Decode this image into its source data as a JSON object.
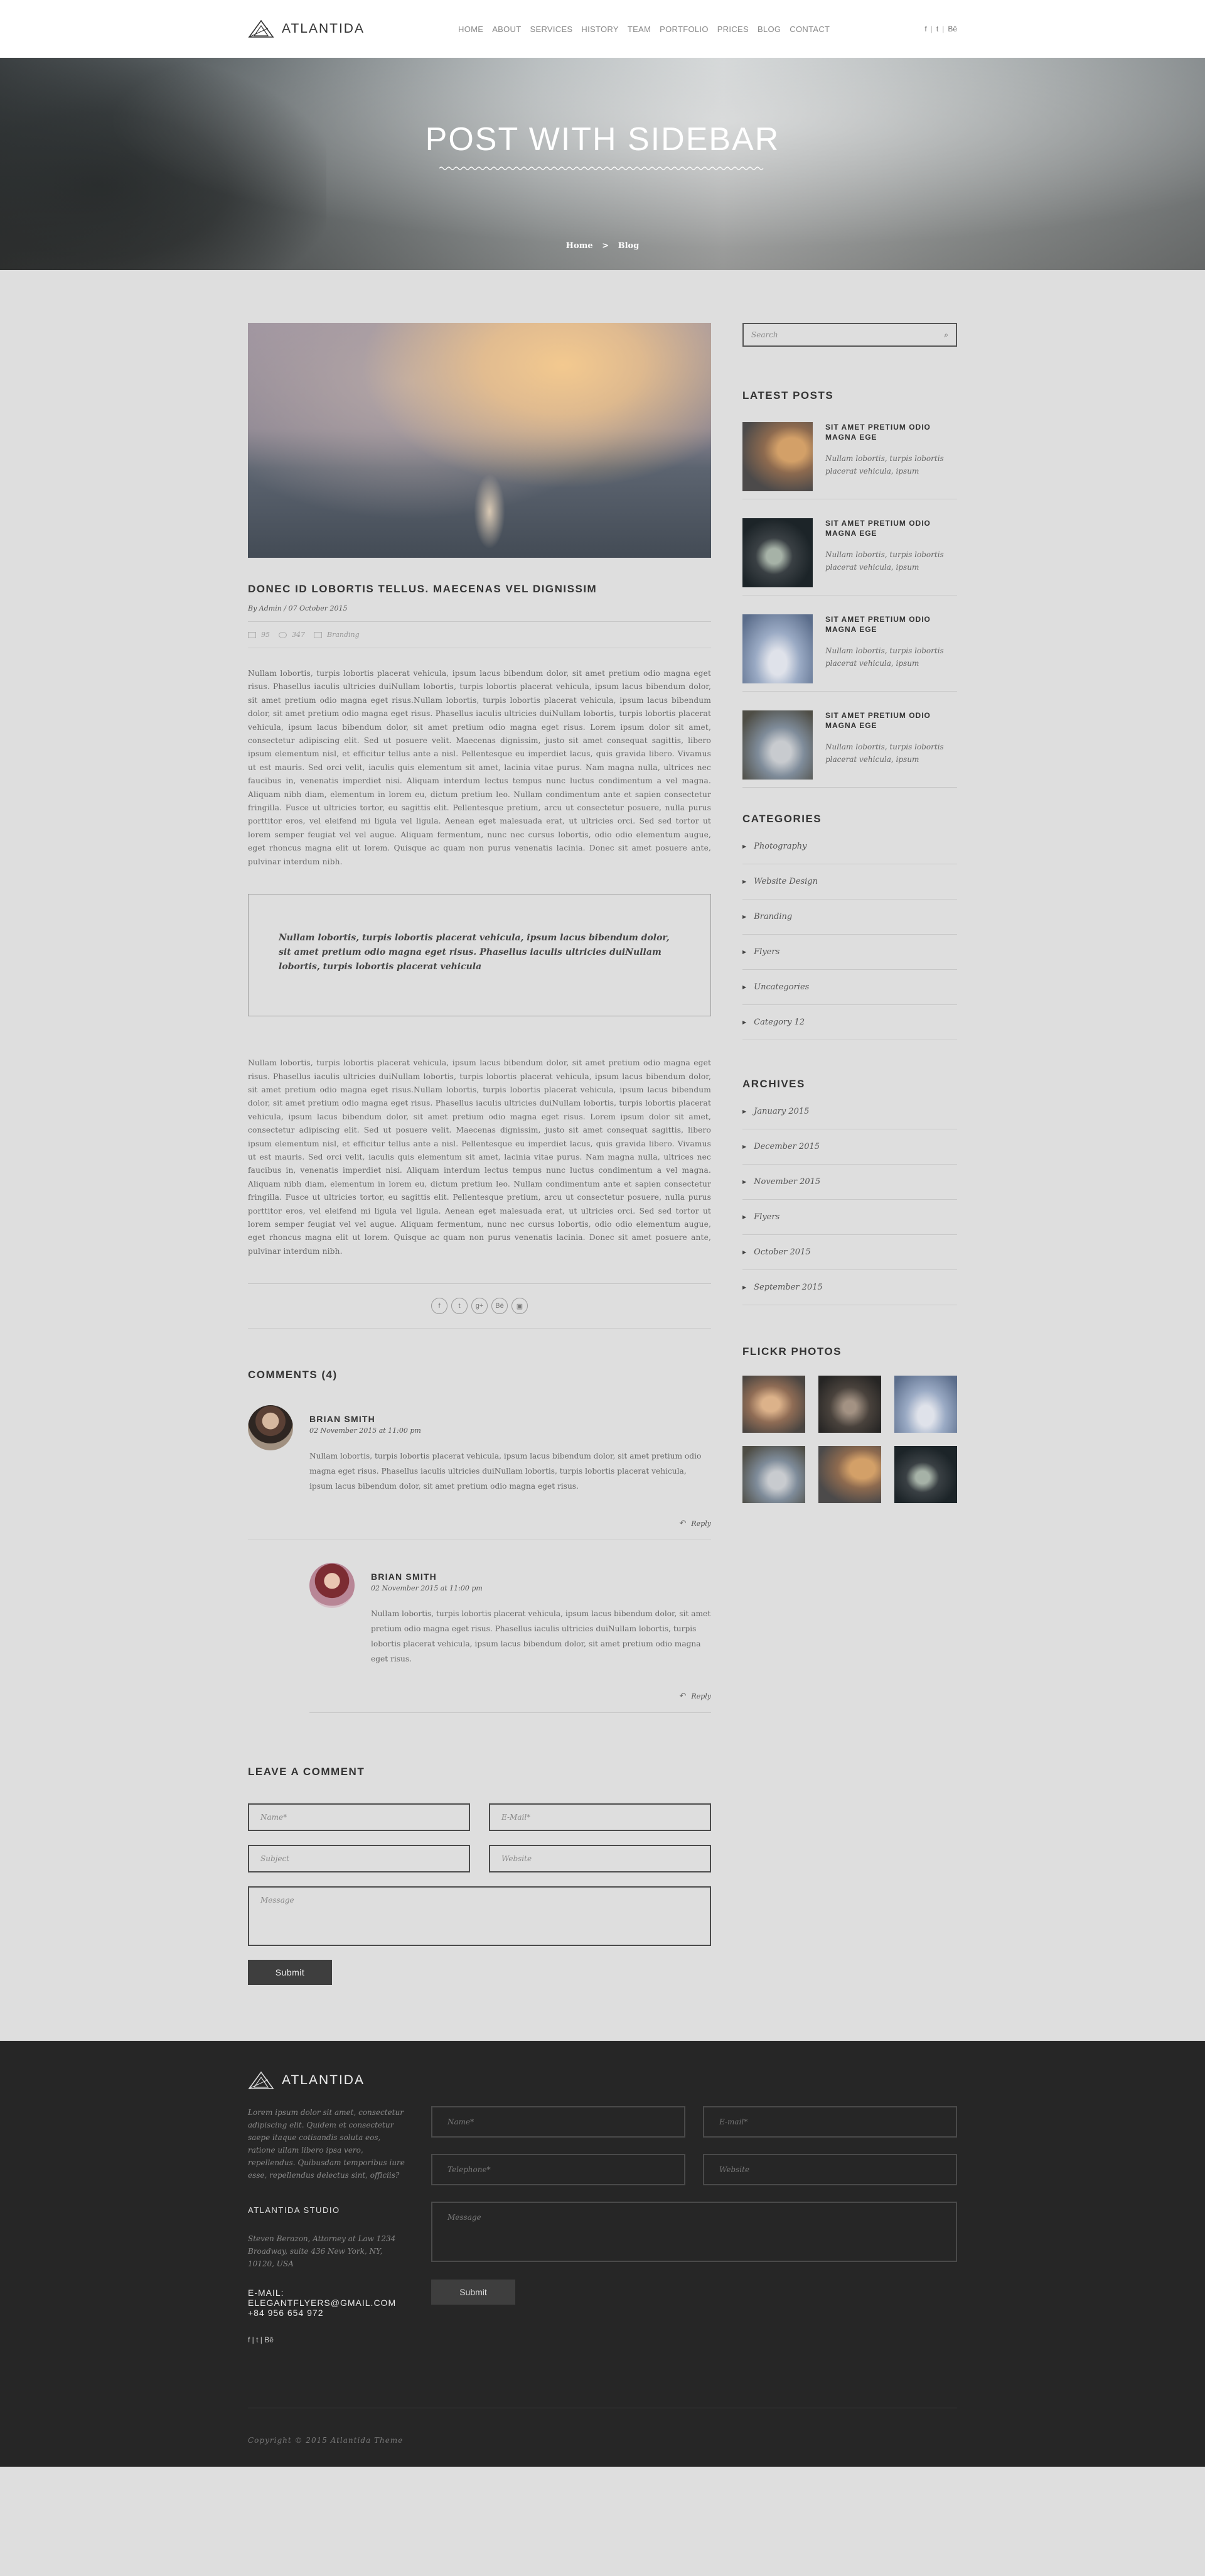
{
  "brand": {
    "name": "ATLANTIDA"
  },
  "nav": [
    "HOME",
    "ABOUT",
    "SERVICES",
    "HISTORY",
    "TEAM",
    "PORTFOLIO",
    "PRICES",
    "BLOG",
    "CONTACT"
  ],
  "social": {
    "facebook": "f",
    "twitter": "t",
    "behance": "Bē",
    "separator": "|"
  },
  "hero": {
    "title": "POST WITH SIDEBAR",
    "crumb_home": "Home",
    "crumb_sep": ">",
    "crumb_current": "Blog"
  },
  "post": {
    "title": "DONEC ID LOBORTIS TELLUS. MAECENAS VEL DIGNISSIM",
    "by": "By Admin / 07 October 2015",
    "comments_count": "95",
    "views": "347",
    "category": "Branding",
    "paragraph1": "Nullam lobortis, turpis lobortis placerat vehicula, ipsum lacus bibendum dolor, sit amet pretium odio magna eget risus. Phasellus iaculis ultricies duiNullam lobortis, turpis lobortis placerat vehicula, ipsum lacus bibendum dolor, sit amet pretium odio magna eget risus.Nullam lobortis, turpis lobortis placerat vehicula, ipsum lacus bibendum dolor, sit amet pretium odio magna eget risus. Phasellus iaculis ultricies duiNullam lobortis, turpis lobortis placerat vehicula, ipsum lacus bibendum dolor, sit amet pretium odio magna eget risus. Lorem ipsum dolor sit amet, consectetur adipiscing elit. Sed ut posuere velit. Maecenas dignissim, justo sit amet consequat sagittis, libero ipsum elementum nisl, et efficitur tellus ante a nisl. Pellentesque eu imperdiet lacus, quis gravida libero. Vivamus ut est mauris. Sed orci velit, iaculis quis elementum sit amet, lacinia vitae purus. Nam magna nulla, ultrices nec faucibus in, venenatis imperdiet nisi. Aliquam interdum lectus tempus nunc luctus condimentum a vel magna. Aliquam nibh diam, elementum in lorem eu, dictum pretium leo. Nullam condimentum ante et sapien consectetur fringilla. Fusce ut ultricies tortor, eu sagittis elit. Pellentesque pretium, arcu ut consectetur posuere, nulla purus porttitor eros, vel eleifend mi ligula vel ligula. Aenean eget malesuada erat, ut ultricies orci. Sed sed tortor ut lorem semper feugiat vel vel augue. Aliquam fermentum, nunc nec cursus lobortis, odio odio elementum augue, eget rhoncus magna elit ut lorem. Quisque ac quam non purus venenatis lacinia. Donec sit amet posuere ante, pulvinar interdum nibh.",
    "quote": "Nullam lobortis, turpis lobortis placerat vehicula, ipsum lacus bibendum dolor, sit amet pretium odio magna eget risus. Phasellus iaculis ultricies duiNullam lobortis, turpis lobortis placerat vehicula",
    "paragraph2": "Nullam lobortis, turpis lobortis placerat vehicula, ipsum lacus bibendum dolor, sit amet pretium odio magna eget risus. Phasellus iaculis ultricies duiNullam lobortis, turpis lobortis placerat vehicula, ipsum lacus bibendum dolor, sit amet pretium odio magna eget risus.Nullam lobortis, turpis lobortis placerat vehicula, ipsum lacus bibendum dolor, sit amet pretium odio magna eget risus. Phasellus iaculis ultricies duiNullam lobortis, turpis lobortis placerat vehicula, ipsum lacus bibendum dolor, sit amet pretium odio magna eget risus. Lorem ipsum dolor sit amet, consectetur adipiscing elit. Sed ut posuere velit. Maecenas dignissim, justo sit amet consequat sagittis, libero ipsum elementum nisl, et efficitur tellus ante a nisl. Pellentesque eu imperdiet lacus, quis gravida libero. Vivamus ut est mauris. Sed orci velit, iaculis quis elementum sit amet, lacinia vitae purus. Nam magna nulla, ultrices nec faucibus in, venenatis imperdiet nisi. Aliquam interdum lectus tempus nunc luctus condimentum a vel magna. Aliquam nibh diam, elementum in lorem eu, dictum pretium leo. Nullam condimentum ante et sapien consectetur fringilla. Fusce ut ultricies tortor, eu sagittis elit. Pellentesque pretium, arcu ut consectetur posuere, nulla purus porttitor eros, vel eleifend mi ligula vel ligula. Aenean eget malesuada erat, ut ultricies orci. Sed sed tortor ut lorem semper feugiat vel vel augue. Aliquam fermentum, nunc nec cursus lobortis, odio odio elementum augue, eget rhoncus magna elit ut lorem. Quisque ac quam non purus venenatis lacinia. Donec sit amet posuere ante, pulvinar interdum nibh."
  },
  "share_icons": [
    "f",
    "t",
    "g+",
    "Bē",
    "▣"
  ],
  "comments": {
    "title": "COMMENTS (4)",
    "items": [
      {
        "name": "BRIAN SMITH",
        "date": "02 November 2015 at 11:00 pm",
        "text": "Nullam lobortis, turpis lobortis placerat vehicula, ipsum lacus bibendum dolor, sit amet pretium odio magna eget risus. Phasellus iaculis ultricies duiNullam lobortis, turpis lobortis placerat vehicula, ipsum lacus bibendum dolor, sit amet pretium odio magna eget risus.",
        "reply": "Reply"
      },
      {
        "name": "BRIAN SMITH",
        "date": "02 November 2015 at 11:00 pm",
        "text": "Nullam lobortis, turpis lobortis placerat vehicula, ipsum lacus bibendum dolor, sit amet pretium odio magna eget risus. Phasellus iaculis ultricies duiNullam lobortis, turpis lobortis placerat vehicula, ipsum lacus bibendum dolor, sit amet pretium odio magna eget risus.",
        "reply": "Reply"
      }
    ]
  },
  "leave_comment": {
    "title": "LEAVE A COMMENT",
    "name_ph": "Name*",
    "email_ph": "E-Mail*",
    "subject_ph": "Subject",
    "website_ph": "Website",
    "message_ph": "Message",
    "submit": "Submit"
  },
  "sidebar": {
    "search_ph": "Search",
    "latest_title": "LATEST POSTS",
    "latest": [
      {
        "title": "SIT AMET PRETIUM ODIO MAGNA EGE",
        "desc": "Nullam lobortis, turpis lobortis placerat vehicula, ipsum"
      },
      {
        "title": "SIT AMET PRETIUM ODIO MAGNA EGE",
        "desc": "Nullam lobortis, turpis lobortis placerat vehicula, ipsum"
      },
      {
        "title": "SIT AMET PRETIUM ODIO MAGNA EGE",
        "desc": "Nullam lobortis, turpis lobortis placerat vehicula, ipsum"
      },
      {
        "title": "SIT AMET PRETIUM ODIO MAGNA EGE",
        "desc": "Nullam lobortis, turpis lobortis placerat vehicula, ipsum"
      }
    ],
    "categories_title": "CATEGORIES",
    "categories": [
      "Photography",
      "Website Design",
      "Branding",
      "Flyers",
      "Uncategories",
      "Category 12"
    ],
    "archives_title": "ARCHIVES",
    "archives": [
      "January 2015",
      "December 2015",
      "November 2015",
      "Flyers",
      "October 2015",
      "September 2015"
    ],
    "flickr_title": "FLICKR PHOTOS"
  },
  "footer": {
    "brand": "ATLANTIDA",
    "intro": "Lorem ipsum dolor sit amet, consectetur adipiscing elit. Quidem et consectetur saepe itaque cotisandis soluta eos, ratione ullam libero ipsa vero, repellendus. Quibusdam temporibus iure esse, repellendus delectus sint, officiis?",
    "studio_title": "ATLANTIDA STUDIO",
    "address": "Steven Berazon, Attorney at Law 1234 Broadway, suite 436 New York, NY, 10120, USA",
    "email_label": "E-MAIL:",
    "email": "ELEGANTFLYERS@GMAIL.COM",
    "phone": "+84 956 654 972",
    "social": "f | t | Bē",
    "name_ph": "Name*",
    "email_ph": "E-mail*",
    "phone_ph": "Telephone*",
    "website_ph": "Website",
    "message_ph": "Message",
    "submit": "Submit",
    "copyright": "Copyright © 2015 Atlantida Theme"
  }
}
